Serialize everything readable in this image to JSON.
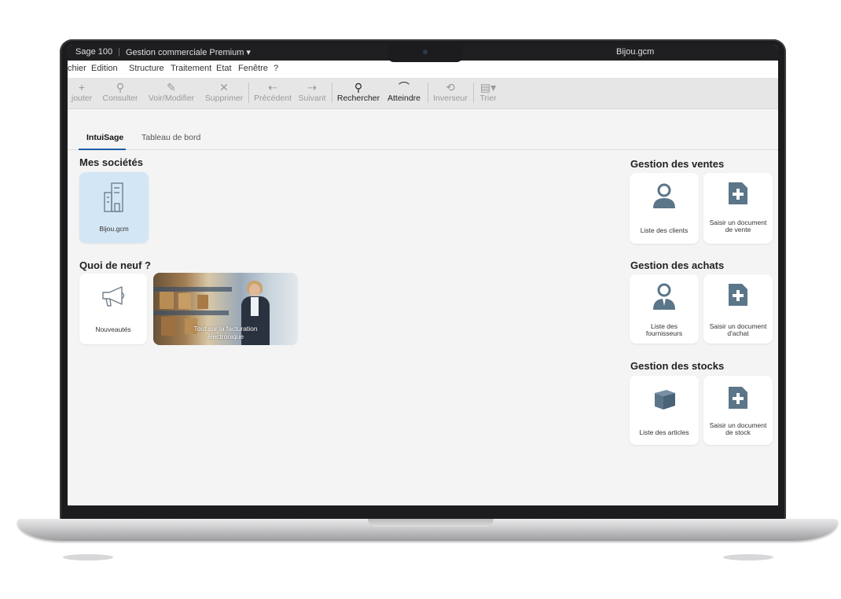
{
  "window": {
    "app_name": "Sage 100",
    "product": "Gestion commerciale Premium ▾",
    "file": "Bijou.gcm"
  },
  "menu": [
    "chier",
    "Edition",
    "Structure",
    "Traitement",
    "Etat",
    "Fenêtre",
    "?"
  ],
  "toolbar": {
    "ajouter": "jouter",
    "consulter": "Consulter",
    "voir_modifier": "Voir/Modifier",
    "supprimer": "Supprimer",
    "precedent": "Précédent",
    "suivant": "Suivant",
    "rechercher": "Rechercher",
    "atteindre": "Atteindre",
    "inverseur": "Inverseur",
    "trier": "Trier"
  },
  "tabs": {
    "intuisage": "IntuiSage",
    "tableau_de_bord": "Tableau de bord"
  },
  "left": {
    "mes_societes_title": "Mes sociétés",
    "company_tile_label": "Bijou.gcm",
    "quoi_de_neuf_title": "Quoi de neuf ?",
    "nouveautes_label": "Nouveautés",
    "promo_caption": "Tout sur la facturation électronique"
  },
  "right": {
    "ventes_title": "Gestion des ventes",
    "liste_clients": "Liste des clients",
    "saisir_vente": "Saisir un document de vente",
    "achats_title": "Gestion des achats",
    "liste_fournisseurs": "Liste des fournisseurs",
    "saisir_achat": "Saisir un document d'achat",
    "stocks_title": "Gestion des stocks",
    "liste_articles": "Liste des articles",
    "saisir_stock": "Saisir un document de stock"
  },
  "colors": {
    "accent": "#1e5fa8",
    "icon_slate": "#5b7589",
    "selected_tile": "#d3e6f5"
  }
}
